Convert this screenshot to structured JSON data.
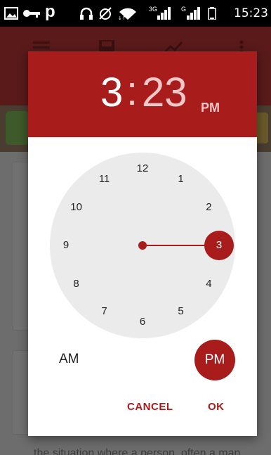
{
  "status_bar": {
    "time": "15:23",
    "icons": [
      "image-icon",
      "key-icon",
      "p-icon",
      "headphones-icon",
      "no-alarm-icon",
      "wifi-icon",
      "signal-3g-icon",
      "signal-icon",
      "battery-icon"
    ],
    "p_label": "p",
    "net_3g": "3G",
    "net_g": "G"
  },
  "background": {
    "toolbar_icons": [
      "list-icon",
      "save-icon",
      "trend-icon",
      "overflow-menu-icon"
    ],
    "footer_text": "the situation where a person, often a man"
  },
  "time_picker": {
    "header": {
      "hour": "3",
      "separator": ":",
      "minute": "23",
      "ampm": "PM"
    },
    "clock": {
      "numbers": [
        "12",
        "1",
        "2",
        "3",
        "4",
        "5",
        "6",
        "7",
        "8",
        "9",
        "10",
        "11"
      ],
      "selected": "3",
      "selected_value": 3
    },
    "am_label": "AM",
    "pm_label": "PM",
    "selected_period": "PM",
    "cancel_label": "CANCEL",
    "ok_label": "OK"
  },
  "colors": {
    "accent": "#a81c1c",
    "header_text_dim": "#f2c7c7",
    "clock_face": "#ebebeb",
    "background_dim": "#6b6b6b"
  }
}
